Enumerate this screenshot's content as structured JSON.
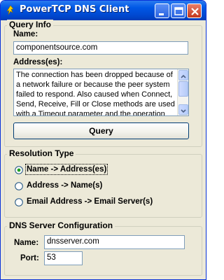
{
  "window": {
    "title": "PowerTCP DNS Client",
    "icons": [
      "app-icon",
      "minimize-icon",
      "maximize-icon",
      "close-icon"
    ]
  },
  "query_info": {
    "legend": "Query Info",
    "name_label": "Name:",
    "name_value": "componentsource.com",
    "address_label": "Address(es):",
    "address_text": "The connection has been dropped because of a network failure or because the peer system failed to respond. Also caused when Connect, Send, Receive, Fill or Close  methods are used with a Timeout parameter and the operation fails to",
    "query_button": "Query"
  },
  "resolution_type": {
    "legend": "Resolution Type",
    "options": [
      {
        "label": "Name -> Address(es)",
        "selected": true
      },
      {
        "label": "Address -> Name(s)",
        "selected": false
      },
      {
        "label": "Email Address -> Email Server(s)",
        "selected": false
      }
    ]
  },
  "dns_server": {
    "legend": "DNS Server Configuration",
    "name_label": "Name:",
    "name_value": "dnsserver.com",
    "port_label": "Port:",
    "port_value": "53"
  },
  "colors": {
    "titlebar": "#0054e3",
    "dialog_bg": "#ece9d8",
    "input_border": "#7f9db9",
    "radio_dot": "#21a121"
  }
}
